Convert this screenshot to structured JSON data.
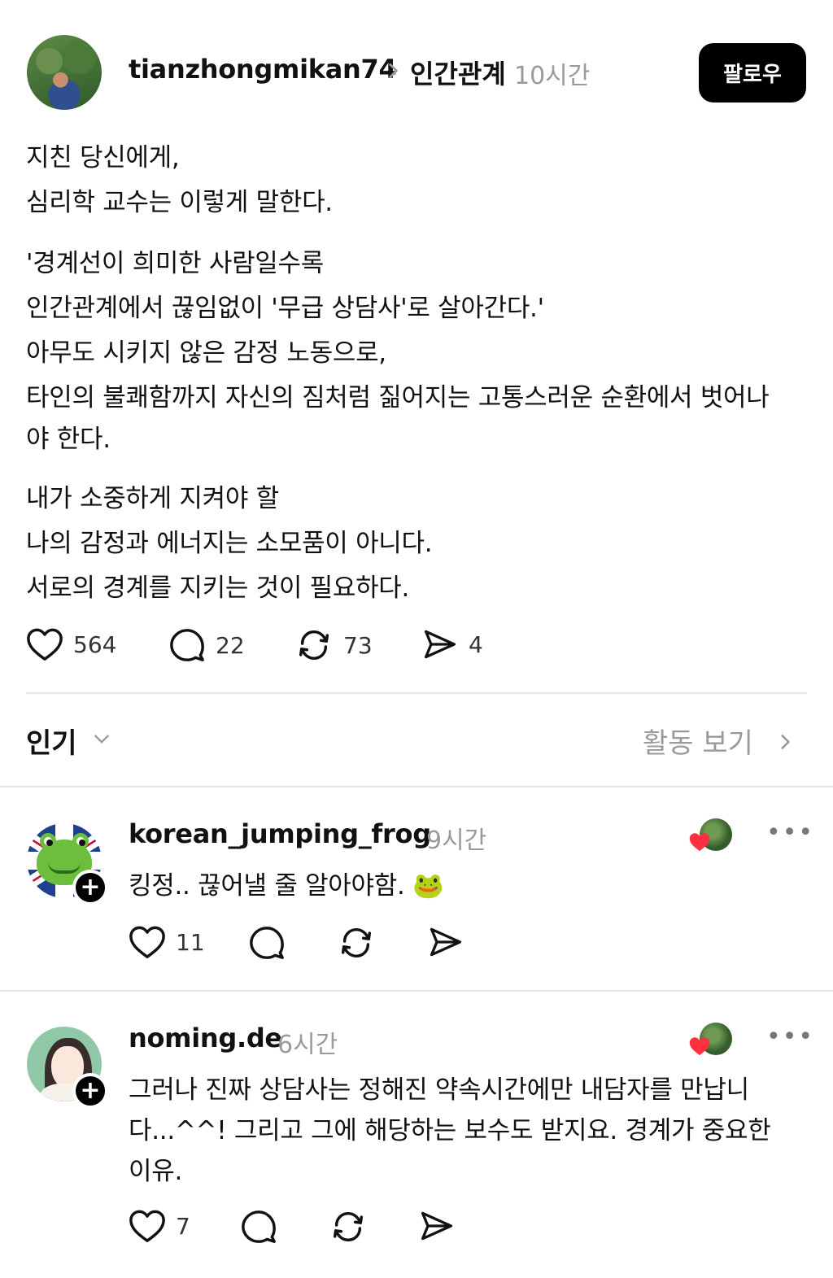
{
  "post": {
    "username": "tianzhongmikan74",
    "topic": "인간관계",
    "time": "10시간",
    "follow_label": "팔로우",
    "lines": [
      "지친 당신에게,",
      "심리학 교수는 이렇게 말한다.",
      "'경계선이 희미한 사람일수록",
      "인간관계에서 끊임없이 '무급 상담사'로 살아간다.'",
      "아무도 시키지 않은 감정 노동으로,",
      "타인의 불쾌함까지 자신의 짐처럼 짊어지는 고통스러운 순환에서 벗어나",
      "야 한다.",
      "내가 소중하게 지켜야 할",
      "나의 감정과 에너지는 소모품이 아니다.",
      "서로의 경계를 지키는 것이 필요하다."
    ],
    "likes": "564",
    "replies": "22",
    "reposts": "73",
    "shares": "4"
  },
  "sort": {
    "label": "인기",
    "activity_label": "활동 보기"
  },
  "comments": [
    {
      "username": "korean_jumping_frog",
      "time": "9시간",
      "lines": [
        "킹정.. 끊어낼 줄 알아야함. 🐸"
      ],
      "likes": "11"
    },
    {
      "username": "noming.de",
      "time": "6시간",
      "lines": [
        "그러나 진짜 상담사는 정해진 약속시간에만 내담자를 만납니",
        "다...^^! 그리고 그에 해당하는 보수도 받지요. 경계가 중요한",
        "이유."
      ],
      "likes": "7"
    }
  ],
  "icons": {
    "like": "heart-icon",
    "reply": "comment-bubble-icon",
    "repost": "repost-icon",
    "share": "send-icon",
    "more": "more-horizontal-icon",
    "follow": "plus-icon"
  },
  "colors": {
    "text": "#111111",
    "muted": "#9a9a9a",
    "button_bg": "#000000",
    "heart_red": "#ff3040",
    "divider": "#e6e6e6"
  }
}
